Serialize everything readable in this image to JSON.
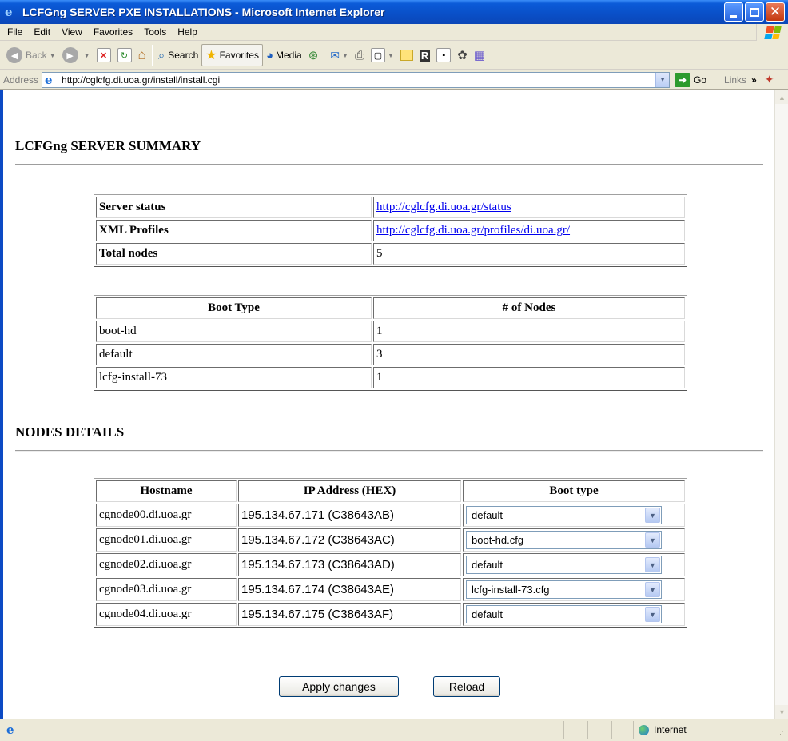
{
  "window": {
    "title": "LCFGng SERVER PXE INSTALLATIONS - Microsoft Internet Explorer"
  },
  "menu": [
    "File",
    "Edit",
    "View",
    "Favorites",
    "Tools",
    "Help"
  ],
  "toolbar": {
    "back": "Back",
    "search": "Search",
    "favorites": "Favorites",
    "media": "Media"
  },
  "address": {
    "label": "Address",
    "url": "http://cglcfg.di.uoa.gr/install/install.cgi",
    "go": "Go",
    "links": "Links",
    "links_chevron": "»"
  },
  "summary": {
    "heading": "LCFGng SERVER SUMMARY",
    "rows": [
      {
        "label": "Server status",
        "value": "http://cglcfg.di.uoa.gr/status"
      },
      {
        "label": "XML Profiles",
        "value": "http://cglcfg.di.uoa.gr/profiles/di.uoa.gr/"
      },
      {
        "label": "Total nodes",
        "value": "5"
      }
    ]
  },
  "boot_table": {
    "headers": [
      "Boot Type",
      "# of Nodes"
    ],
    "rows": [
      {
        "type": "boot-hd",
        "count": "1"
      },
      {
        "type": "default",
        "count": "3"
      },
      {
        "type": "lcfg-install-73",
        "count": "1"
      }
    ]
  },
  "nodes": {
    "heading": "NODES DETAILS",
    "headers": [
      "Hostname",
      "IP Address (HEX)",
      "Boot type"
    ],
    "rows": [
      {
        "host": "cgnode00.di.uoa.gr",
        "ip": "195.134.67.171 (C38643AB)",
        "boot": "default"
      },
      {
        "host": "cgnode01.di.uoa.gr",
        "ip": "195.134.67.172 (C38643AC)",
        "boot": "boot-hd.cfg"
      },
      {
        "host": "cgnode02.di.uoa.gr",
        "ip": "195.134.67.173 (C38643AD)",
        "boot": "default"
      },
      {
        "host": "cgnode03.di.uoa.gr",
        "ip": "195.134.67.174 (C38643AE)",
        "boot": "lcfg-install-73.cfg"
      },
      {
        "host": "cgnode04.di.uoa.gr",
        "ip": "195.134.67.175 (C38643AF)",
        "boot": "default"
      }
    ]
  },
  "buttons": {
    "apply": "Apply changes",
    "reload": "Reload"
  },
  "status": {
    "zone": "Internet"
  },
  "colors": {
    "titlebar": "#0b5bd8",
    "link": "#0000ee",
    "chrome": "#ece9d8"
  }
}
